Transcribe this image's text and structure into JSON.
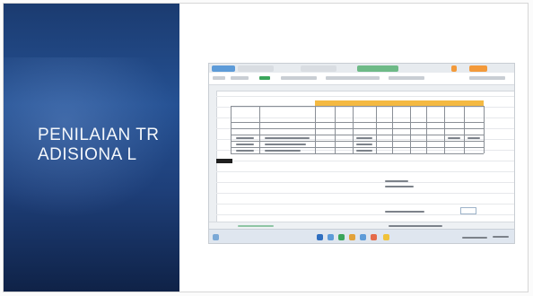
{
  "slide": {
    "title": "PENILAIAN TRADISIONA L"
  },
  "colors": {
    "panel": "#255193",
    "accent_orange": "#f4b942",
    "tab_orange": "#f39a3b",
    "tab_green": "#3aa55b",
    "tab_blue": "#5d9bd8"
  },
  "embedded_screenshot": {
    "app": "spreadsheet",
    "description_icons": [
      "spreadsheet-icon",
      "browser-icon",
      "folder-icon",
      "mail-icon",
      "settings-icon",
      "windows-start-icon"
    ]
  }
}
